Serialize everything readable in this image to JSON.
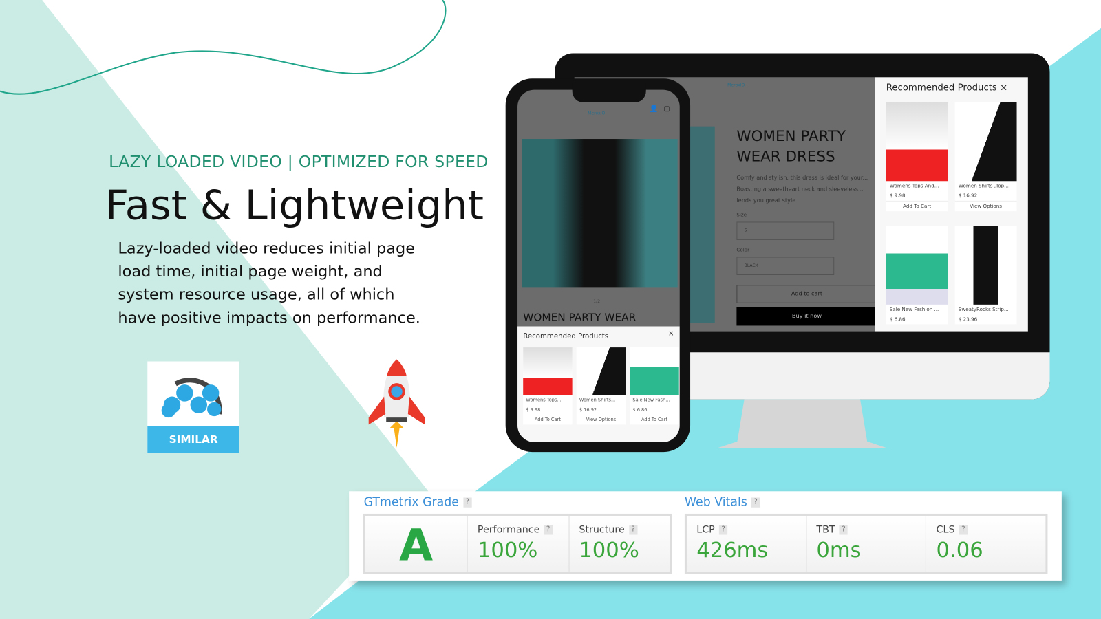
{
  "headline": {
    "subtitle": "LAZY LOADED VIDEO | OPTIMIZED FOR SPEED",
    "title": "Fast & Lightweight",
    "description": "Lazy-loaded  video reduces initial page load time, initial page weight, and system resource usage, all of which have positive impacts on performance."
  },
  "logo": {
    "badge": "SIMILAR",
    "brand_color": "#3db7e8"
  },
  "desktop": {
    "brand": "MeroxIO",
    "product_title": "WOMEN PARTY WEAR DRESS",
    "product_desc": "Comfy and stylish, this dress is ideal for your... Boasting a sweetheart neck and sleeveless... lends you great style.",
    "size_label": "Size",
    "size_value": "S",
    "color_label": "Color",
    "color_value": "BLACK",
    "add_to_cart": "Add to cart",
    "buy_now": "Buy it now",
    "recommended": {
      "title": "Recommended Products",
      "close": "×",
      "items": [
        {
          "name": "Womens Tops And...",
          "price": "$ 9.98",
          "action": "Add To Cart"
        },
        {
          "name": "Women Shirts ,Top...",
          "price": "$ 16.92",
          "action": "View Options"
        },
        {
          "name": "Sale New Fashion ...",
          "price": "$ 6.86"
        },
        {
          "name": "SweatyRocks Strip...",
          "price": "$ 23.96"
        }
      ]
    }
  },
  "mobile": {
    "brand": "MeroxIO",
    "pager": "1/2",
    "product_title": "WOMEN PARTY WEAR",
    "recommended": {
      "title": "Recommended Products",
      "close": "×",
      "items": [
        {
          "name": "Womens Tops...",
          "price": "$ 9.98",
          "action": "Add To Cart"
        },
        {
          "name": "Women Shirts...",
          "price": "$ 16.92",
          "action": "View Options"
        },
        {
          "name": "Sale New Fash...",
          "price": "$ 6.86",
          "action": "Add To Cart"
        }
      ]
    }
  },
  "gtmetrix": {
    "grade_title": "GTmetrix Grade",
    "grade": "A",
    "help": "?",
    "performance_label": "Performance",
    "performance": "100%",
    "structure_label": "Structure",
    "structure": "100%",
    "vitals_title": "Web Vitals",
    "lcp_label": "LCP",
    "lcp": "426ms",
    "tbt_label": "TBT",
    "tbt": "0ms",
    "cls_label": "CLS",
    "cls": "0.06",
    "value_color": "#3aa53a"
  }
}
